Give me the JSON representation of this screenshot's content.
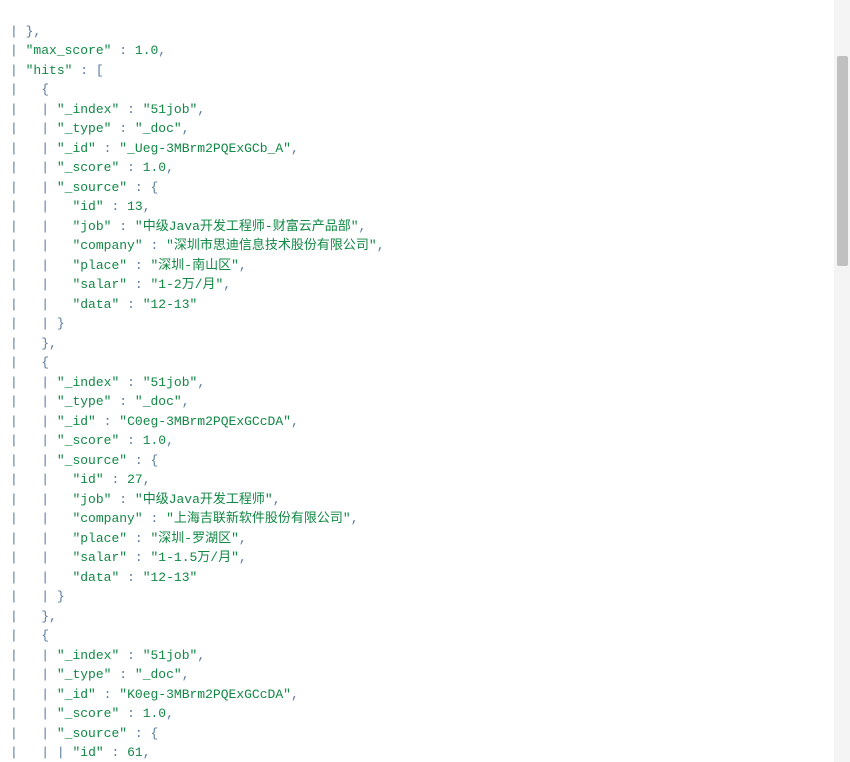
{
  "top": {
    "closing_brace_comma": "},",
    "max_score_key": "\"max_score\"",
    "max_score_val": "1.0",
    "hits_key": "\"hits\""
  },
  "hits": [
    {
      "index_k": "\"_index\"",
      "index_v": "\"51job\"",
      "type_k": "\"_type\"",
      "type_v": "\"_doc\"",
      "id_k": "\"_id\"",
      "id_v": "\"_Ueg-3MBrm2PQExGCb_A\"",
      "score_k": "\"_score\"",
      "score_v": "1.0",
      "source_k": "\"_source\"",
      "src": {
        "id_k": "\"id\"",
        "id_v": "13",
        "job_k": "\"job\"",
        "job_v": "\"中级Java开发工程师-财富云产品部\"",
        "company_k": "\"company\"",
        "company_v": "\"深圳市思迪信息技术股份有限公司\"",
        "place_k": "\"place\"",
        "place_v": "\"深圳-南山区\"",
        "salar_k": "\"salar\"",
        "salar_v": "\"1-2万/月\"",
        "data_k": "\"data\"",
        "data_v": "\"12-13\""
      }
    },
    {
      "index_k": "\"_index\"",
      "index_v": "\"51job\"",
      "type_k": "\"_type\"",
      "type_v": "\"_doc\"",
      "id_k": "\"_id\"",
      "id_v": "\"C0eg-3MBrm2PQExGCcDA\"",
      "score_k": "\"_score\"",
      "score_v": "1.0",
      "source_k": "\"_source\"",
      "src": {
        "id_k": "\"id\"",
        "id_v": "27",
        "job_k": "\"job\"",
        "job_v": "\"中级Java开发工程师\"",
        "company_k": "\"company\"",
        "company_v": "\"上海吉联新软件股份有限公司\"",
        "place_k": "\"place\"",
        "place_v": "\"深圳-罗湖区\"",
        "salar_k": "\"salar\"",
        "salar_v": "\"1-1.5万/月\"",
        "data_k": "\"data\"",
        "data_v": "\"12-13\""
      }
    },
    {
      "index_k": "\"_index\"",
      "index_v": "\"51job\"",
      "type_k": "\"_type\"",
      "type_v": "\"_doc\"",
      "id_k": "\"_id\"",
      "id_v": "\"K0eg-3MBrm2PQExGCcDA\"",
      "score_k": "\"_score\"",
      "score_v": "1.0",
      "source_k": "\"_source\"",
      "src": {
        "id_k": "\"id\"",
        "id_v": "61"
      }
    }
  ]
}
